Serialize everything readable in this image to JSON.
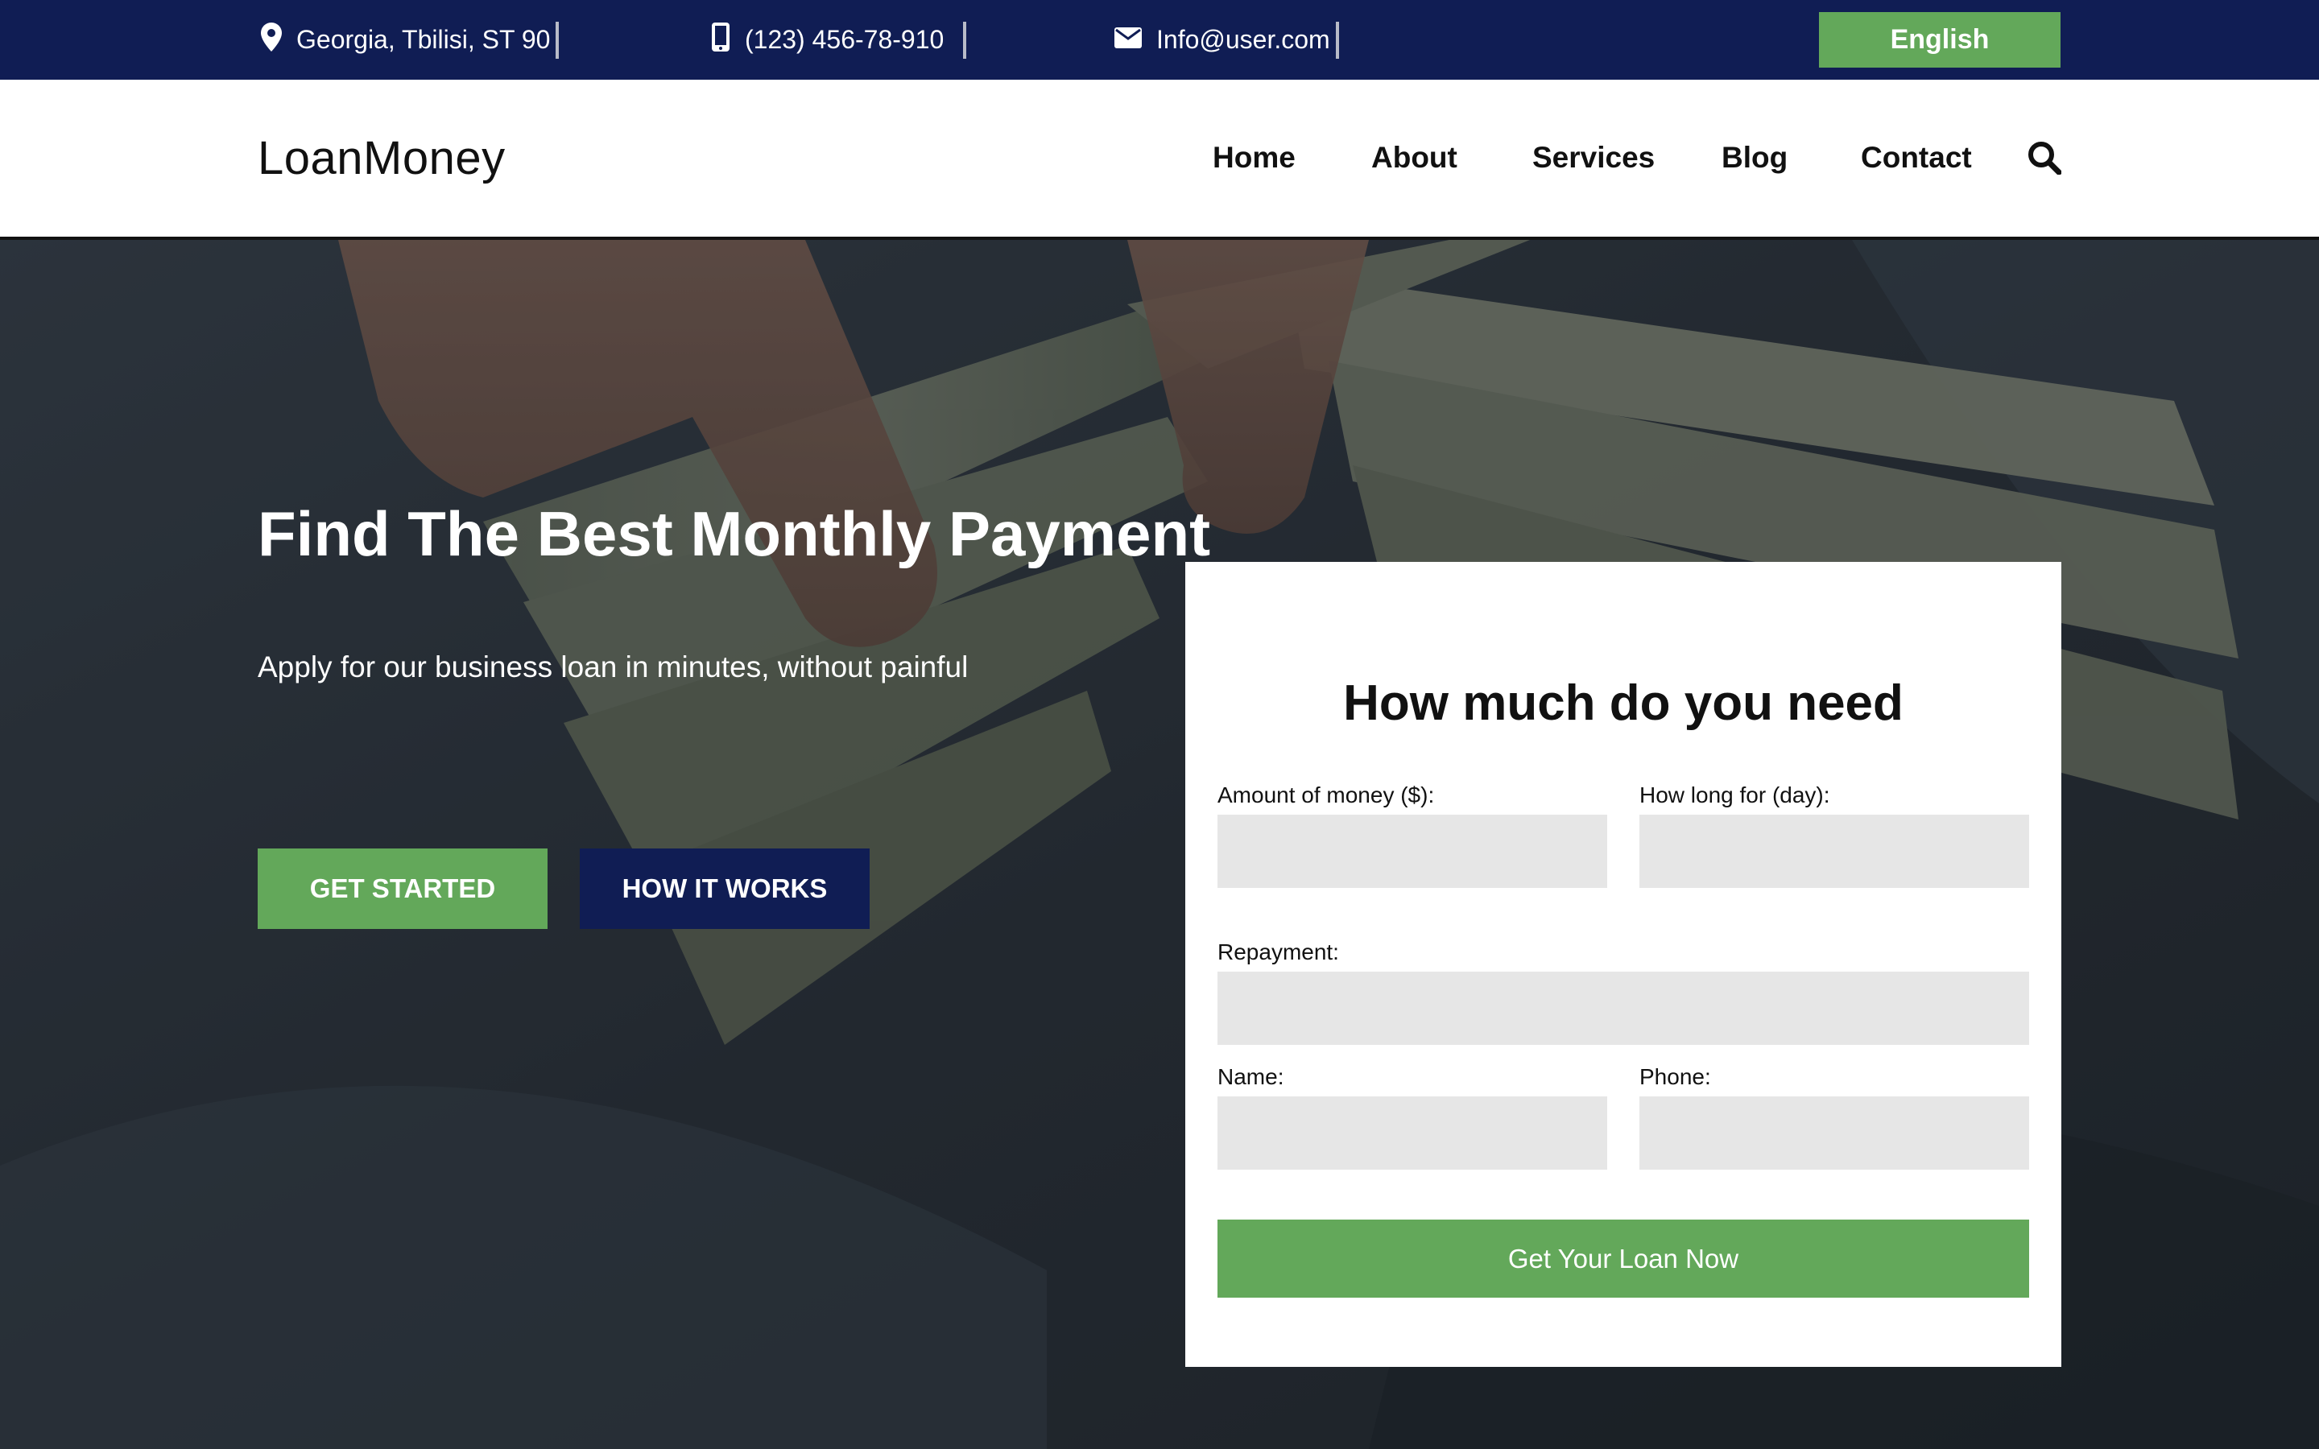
{
  "colors": {
    "navy": "#101d54",
    "green": "#63a85a",
    "white": "#ffffff",
    "input_bg": "#e6e6e6",
    "text_dark": "#111111"
  },
  "topbar": {
    "address": "Georgia, Tbilisi, ST 90",
    "phone": "(123) 456-78-910",
    "email": "Info@user.com",
    "language": "English",
    "icons": [
      "location-pin-icon",
      "mobile-phone-icon",
      "envelope-icon"
    ]
  },
  "navbar": {
    "logo": "LoanMoney",
    "links": [
      "Home",
      "About",
      "Services",
      "Blog",
      "Contact"
    ],
    "search_icon": "search-icon"
  },
  "hero": {
    "title": "Find The Best Monthly Payment",
    "subtitle": "Apply for our business loan in minutes, without painful",
    "get_started": "GET STARTED",
    "how_it_works": "HOW IT WORKS"
  },
  "form": {
    "title": "How much do you need",
    "amount_label": "Amount of money ($):",
    "duration_label": "How long for (day):",
    "repayment_label": "Repayment:",
    "name_label": "Name:",
    "phone_label": "Phone:",
    "amount_value": "",
    "duration_value": "",
    "repayment_value": "",
    "name_value": "",
    "phone_value": "",
    "submit": "Get Your Loan Now"
  }
}
